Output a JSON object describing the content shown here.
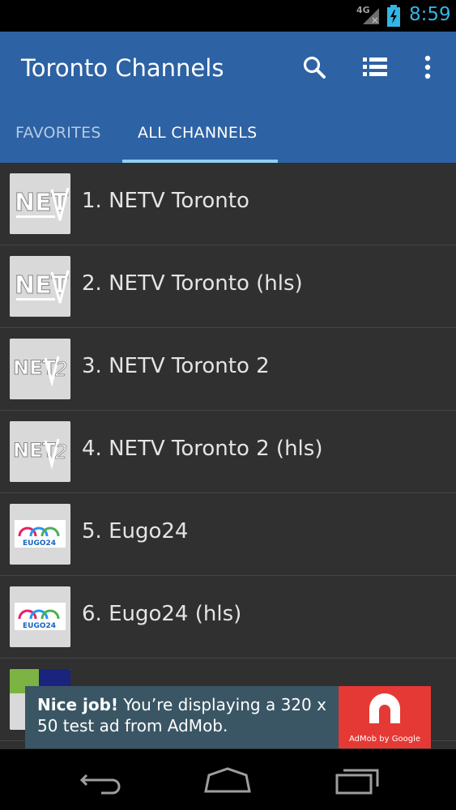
{
  "status_bar": {
    "network": "4G",
    "time": "8:59",
    "time_color": "#33b5e5"
  },
  "app_bar": {
    "title": "Toronto Channels",
    "color": "#2d62a4",
    "actions": [
      "search-icon",
      "list-view-icon",
      "more-vert-icon"
    ]
  },
  "tabs": [
    {
      "label": "FAVORITES",
      "selected": false
    },
    {
      "label": "ALL CHANNELS",
      "selected": true
    }
  ],
  "channels": [
    {
      "label": "1. NETV Toronto",
      "logo": "netv-logo"
    },
    {
      "label": "2. NETV Toronto (hls)",
      "logo": "netv-logo"
    },
    {
      "label": "3. NETV Toronto 2",
      "logo": "netv2-logo"
    },
    {
      "label": "4. NETV Toronto 2 (hls)",
      "logo": "netv2-logo"
    },
    {
      "label": "5. Eugo24",
      "logo": "eugo24-logo"
    },
    {
      "label": "6. Eugo24 (hls)",
      "logo": "eugo24-logo"
    }
  ],
  "ad": {
    "headline": "Nice job!",
    "body": " You’re displaying a 320 x 50 test ad from AdMob.",
    "brand": "AdMob by Google",
    "logo_color": "#e53935"
  },
  "nav_bar": [
    "back-icon",
    "home-icon",
    "recents-icon"
  ]
}
